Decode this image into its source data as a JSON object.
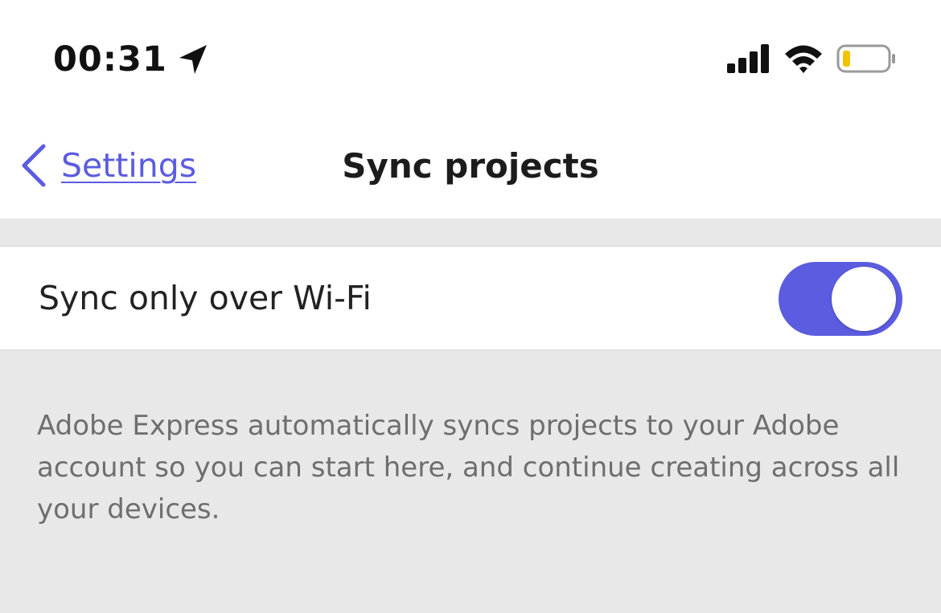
{
  "status_bar": {
    "time": "00:31",
    "icons": [
      "location-arrow-icon",
      "cellular-signal-icon",
      "wifi-icon",
      "battery-low-icon"
    ],
    "battery_color": "#f2c200"
  },
  "nav": {
    "back_label": "Settings",
    "title": "Sync projects",
    "accent_color": "#5c5ce0"
  },
  "setting": {
    "label": "Sync only over Wi-Fi",
    "toggle_on": true,
    "toggle_color": "#5c5ce0"
  },
  "footer": {
    "description": "Adobe Express automatically syncs projects to your Adobe account so you can start here, and continue creating across all your devices."
  }
}
